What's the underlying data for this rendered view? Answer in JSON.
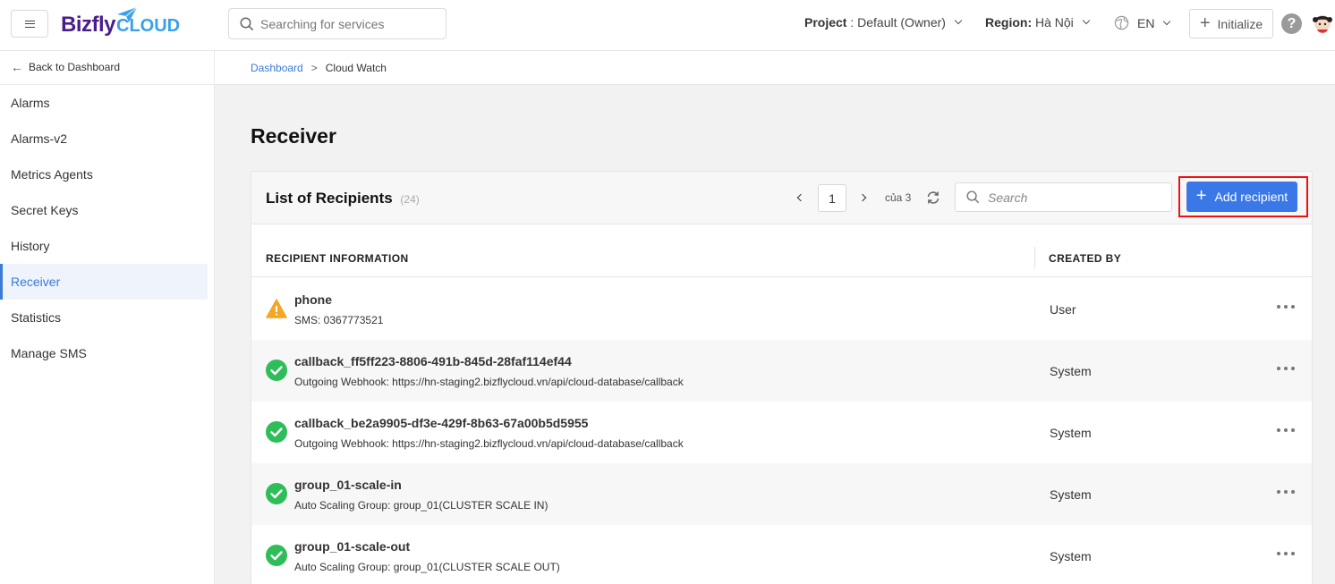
{
  "header": {
    "logo_text_main": "Bizfly",
    "logo_text_cloud": "CLOUD",
    "search_placeholder": "Searching for services",
    "project_label": "Project",
    "project_value": " : Default (Owner)",
    "region_label": "Region:",
    "region_value": " Hà Nội",
    "language": "EN",
    "initialize_label": "Initialize",
    "help_glyph": "?",
    "icons": {
      "menu": "menu-icon",
      "search": "search-icon",
      "globe": "globe-icon",
      "plus": "plus-icon",
      "help": "help-icon",
      "avatar": "avatar-icon"
    }
  },
  "sidebar": {
    "back_label": "Back to Dashboard",
    "items": [
      {
        "label": "Alarms",
        "active": false
      },
      {
        "label": "Alarms-v2",
        "active": false
      },
      {
        "label": "Metrics Agents",
        "active": false
      },
      {
        "label": "Secret Keys",
        "active": false
      },
      {
        "label": "History",
        "active": false
      },
      {
        "label": "Receiver",
        "active": true
      },
      {
        "label": "Statistics",
        "active": false
      },
      {
        "label": "Manage SMS",
        "active": false
      }
    ]
  },
  "breadcrumb": {
    "root": "Dashboard",
    "separator": ">",
    "current": "Cloud Watch"
  },
  "page": {
    "title": "Receiver"
  },
  "panel": {
    "title": "List of Recipients",
    "count": "(24)",
    "page": "1",
    "page_of": "của 3",
    "search_placeholder": "Search",
    "add_label": "Add recipient",
    "columns": {
      "info": "RECIPIENT INFORMATION",
      "created_by": "CREATED BY"
    },
    "rows": [
      {
        "status": "warning",
        "name": "phone",
        "detail": "SMS: 0367773521",
        "created_by": "User"
      },
      {
        "status": "ok",
        "name": "callback_ff5ff223-8806-491b-845d-28faf114ef44",
        "detail": "Outgoing Webhook: https://hn-staging2.bizflycloud.vn/api/cloud-database/callback",
        "created_by": "System"
      },
      {
        "status": "ok",
        "name": "callback_be2a9905-df3e-429f-8b63-67a00b5d5955",
        "detail": "Outgoing Webhook: https://hn-staging2.bizflycloud.vn/api/cloud-database/callback",
        "created_by": "System"
      },
      {
        "status": "ok",
        "name": "group_01-scale-in",
        "detail": "Auto Scaling Group: group_01(CLUSTER SCALE IN)",
        "created_by": "System"
      },
      {
        "status": "ok",
        "name": "group_01-scale-out",
        "detail": "Auto Scaling Group: group_01(CLUSTER SCALE OUT)",
        "created_by": "System"
      }
    ]
  },
  "colors": {
    "accent": "#3b78e7",
    "link": "#3a7bd5",
    "ok": "#2ebd59",
    "warning": "#f5a623",
    "highlight": "#e11111"
  }
}
